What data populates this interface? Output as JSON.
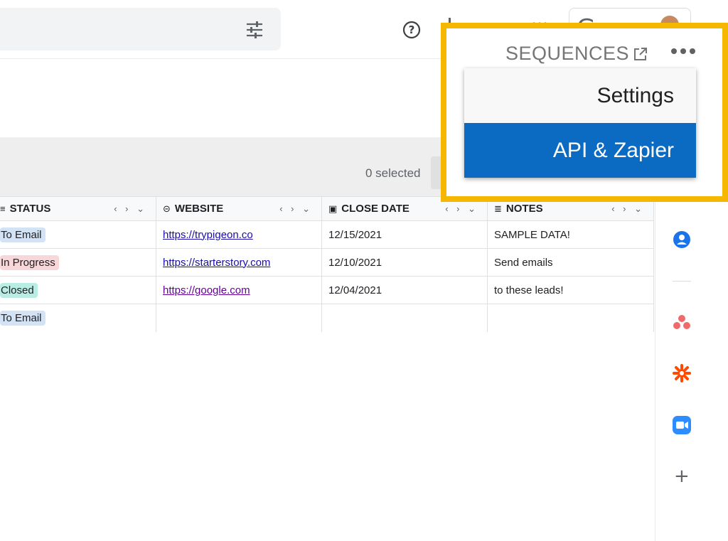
{
  "header": {
    "icons": [
      "tune-icon",
      "help-icon",
      "grip-icon",
      "apps-dots-icon",
      "account-avatar"
    ],
    "google_logo_partial": "G o o g l"
  },
  "toolbar": {
    "selected_text": "0 selected"
  },
  "sequences_menu": {
    "title": "SEQUENCES",
    "items": [
      {
        "label": "Settings",
        "active": false
      },
      {
        "label": "API & Zapier",
        "active": true
      }
    ],
    "highlight_color": "#f6b700",
    "active_color": "#0b6bc2"
  },
  "table": {
    "columns": [
      {
        "label": "STATUS",
        "icon": "≡"
      },
      {
        "label": "WEBSITE",
        "icon": "⊝"
      },
      {
        "label": "CLOSE DATE",
        "icon": "▣"
      },
      {
        "label": "NOTES",
        "icon": "≣"
      }
    ],
    "column_controls": "‹ › ⌄",
    "rows": [
      {
        "status": "To Email",
        "status_color": "#d3e3f5",
        "website": "https://trypigeon.co",
        "close_date": "12/15/2021",
        "notes": "SAMPLE DATA!"
      },
      {
        "status": "In Progress",
        "status_color": "#f8d7d9",
        "website": "https://starterstory.com",
        "close_date": "12/10/2021",
        "notes": "Send emails"
      },
      {
        "status": "Closed",
        "status_color": "#b9ede3",
        "website": "https://google.com",
        "close_date": "12/04/2021",
        "notes": "to these leads!"
      },
      {
        "status": "To Email",
        "status_color": "#d3e3f5",
        "website": "",
        "close_date": "",
        "notes": ""
      }
    ]
  },
  "side_panel": {
    "icons": [
      "contacts-icon",
      "asana-icon",
      "zapier-icon",
      "zoom-icon",
      "add-icon"
    ],
    "add_label": "+"
  }
}
